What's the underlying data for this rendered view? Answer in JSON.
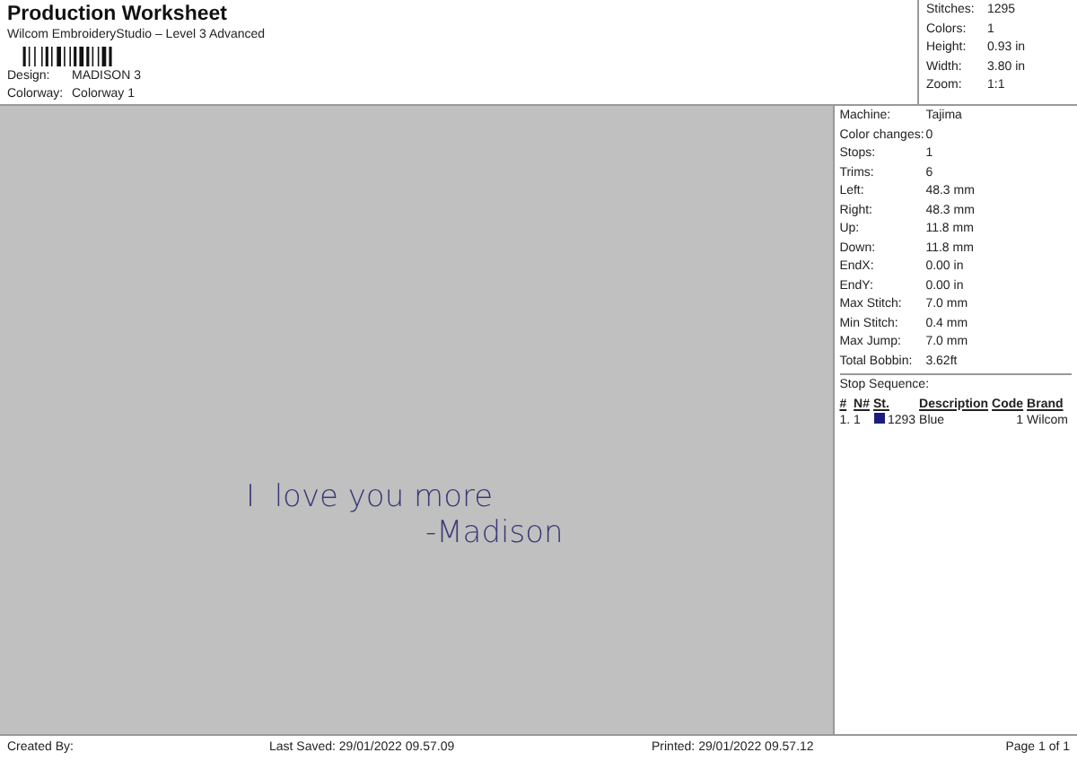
{
  "header": {
    "title": "Production Worksheet",
    "subtitle": "Wilcom EmbroideryStudio – Level 3 Advanced",
    "fields": [
      {
        "label": "Design:",
        "value": "MADISON 3"
      },
      {
        "label": "Colorway:",
        "value": "Colorway 1"
      }
    ]
  },
  "summary": [
    {
      "label": "Stitches:",
      "value": "1295"
    },
    {
      "label": "Colors:",
      "value": "1"
    },
    {
      "label": "Height:",
      "value": "0.93 in"
    },
    {
      "label": "Width:",
      "value": "3.80 in"
    },
    {
      "label": "Zoom:",
      "value": "1:1"
    }
  ],
  "design_preview": {
    "lines": [
      "I  love you more",
      "-Madison"
    ]
  },
  "details": [
    {
      "label": "Machine:",
      "value": "Tajima"
    },
    {
      "label": "Color changes:",
      "value": "0"
    },
    {
      "label": "Stops:",
      "value": "1"
    },
    {
      "label": "Trims:",
      "value": "6"
    },
    {
      "label": "Left:",
      "value": "48.3 mm"
    },
    {
      "label": "Right:",
      "value": "48.3 mm"
    },
    {
      "label": "Up:",
      "value": "11.8 mm"
    },
    {
      "label": "Down:",
      "value": "11.8 mm"
    },
    {
      "label": "EndX:",
      "value": "0.00 in"
    },
    {
      "label": "EndY:",
      "value": "0.00 in"
    },
    {
      "label": "Max Stitch:",
      "value": "7.0 mm"
    },
    {
      "label": "Min Stitch:",
      "value": "0.4 mm"
    },
    {
      "label": "Max Jump:",
      "value": "7.0 mm"
    },
    {
      "label": "Total Bobbin:",
      "value": "3.62ft"
    }
  ],
  "stop_sequence": {
    "title": "Stop Sequence:",
    "columns": [
      "#",
      "N#",
      "St.",
      "Description",
      "Code",
      "Brand"
    ],
    "rows": [
      {
        "index": "1.",
        "needle": "1",
        "color": "#1c1c80",
        "stitches": "1293",
        "description": "Blue",
        "code": "1",
        "brand": "Wilcom"
      }
    ]
  },
  "footer": {
    "created": "Created By:",
    "saved": "Last Saved: 29/01/2022 09.57.09",
    "printed": "Printed: 29/01/2022 09.57.12",
    "page": "Page 1 of 1"
  }
}
